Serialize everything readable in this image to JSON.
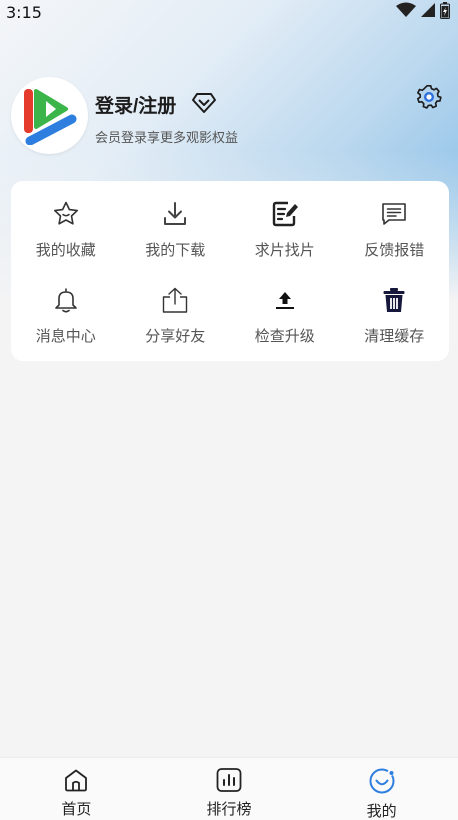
{
  "status_bar": {
    "time": "3:15"
  },
  "profile": {
    "title": "登录/注册",
    "subtitle": "会员登录享更多观影权益"
  },
  "menu": {
    "items": [
      {
        "label": "我的收藏",
        "icon": "star-icon"
      },
      {
        "label": "我的下载",
        "icon": "download-icon"
      },
      {
        "label": "求片找片",
        "icon": "edit-note-icon"
      },
      {
        "label": "反馈报错",
        "icon": "message-icon"
      },
      {
        "label": "消息中心",
        "icon": "bell-icon"
      },
      {
        "label": "分享好友",
        "icon": "share-icon"
      },
      {
        "label": "检查升级",
        "icon": "upload-icon"
      },
      {
        "label": "清理缓存",
        "icon": "trash-icon"
      }
    ]
  },
  "tabbar": {
    "tabs": [
      {
        "label": "首页",
        "icon": "home-icon"
      },
      {
        "label": "排行榜",
        "icon": "chart-icon"
      },
      {
        "label": "我的",
        "icon": "profile-smile-icon"
      }
    ]
  },
  "colors": {
    "accent_blue": "#2f7fe0",
    "logo_red": "#e53b2c",
    "logo_green": "#3bb54a",
    "logo_blue": "#2e7ee0",
    "gear_blue": "#2f6fdc"
  }
}
